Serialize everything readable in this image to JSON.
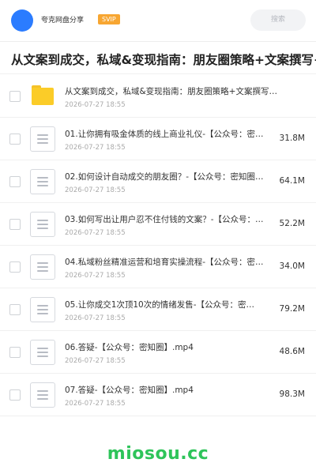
{
  "header": {
    "app_name": "夸克网盘分享",
    "badge": "SVIP",
    "search_label": "搜索",
    "avatar_color": "#2b7cff"
  },
  "title": "从文案到成交，私域&变现指南：朋友圈策略+文案撰写+私域",
  "files": [
    {
      "name": "从文案到成交，私域&变现指南：朋友圈策略+文案撰写…",
      "date": "2026-07-27 18:55",
      "size": "",
      "type": "folder"
    },
    {
      "name": "01.让你拥有吸金体质的线上商业礼仪-【公众号：密…",
      "date": "2026-07-27 18:55",
      "size": "31.8M",
      "type": "file"
    },
    {
      "name": "02.如何设计自动成交的朋友圈？-【公众号：密知圈…",
      "date": "2026-07-27 18:55",
      "size": "64.1M",
      "type": "file"
    },
    {
      "name": "03.如何写出让用户忍不住付钱的文案？-【公众号：…",
      "date": "2026-07-27 18:55",
      "size": "52.2M",
      "type": "file"
    },
    {
      "name": "04.私域粉丝精准运营和培育实操流程-【公众号：密…",
      "date": "2026-07-27 18:55",
      "size": "34.0M",
      "type": "file"
    },
    {
      "name": "05.让你成交1次顶10次的情绪发售-【公众号：密…",
      "date": "2026-07-27 18:55",
      "size": "79.2M",
      "type": "file"
    },
    {
      "name": "06.答疑-【公众号：密知圈】.mp4",
      "date": "2026-07-27 18:55",
      "size": "48.6M",
      "type": "file"
    },
    {
      "name": "07.答疑-【公众号：密知圈】.mp4",
      "date": "2026-07-27 18:55",
      "size": "98.3M",
      "type": "file"
    }
  ],
  "watermark": "miosou.cc",
  "colors": {
    "badge": "#f7a632",
    "folder": "#fbcc28",
    "watermark": "#2ec45a"
  }
}
